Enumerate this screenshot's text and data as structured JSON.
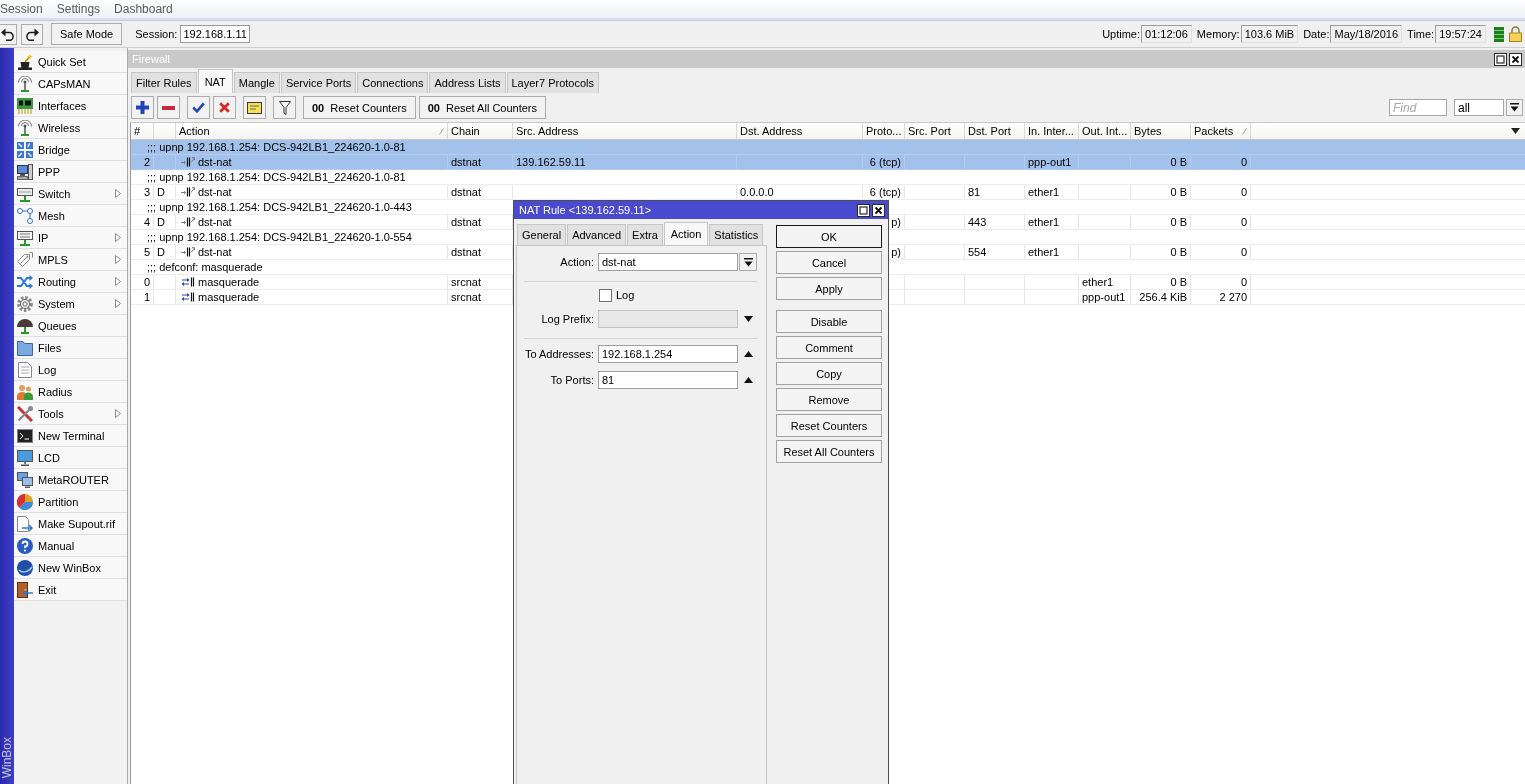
{
  "menu_bar": {
    "items": [
      "Session",
      "Settings",
      "Dashboard"
    ]
  },
  "toolbar": {
    "safe_mode": "Safe Mode",
    "session_label": "Session:",
    "session_value": "192.168.1.11",
    "status": [
      {
        "label": "Uptime:",
        "value": "01:12:06"
      },
      {
        "label": "Memory:",
        "value": "103.6 MiB"
      },
      {
        "label": "Date:",
        "value": "May/18/2016"
      },
      {
        "label": "Time:",
        "value": "19:57:24"
      }
    ]
  },
  "side_label": "WinBox",
  "sidebar": {
    "items": [
      {
        "label": "Quick Set",
        "submenu": false
      },
      {
        "label": "CAPsMAN",
        "submenu": false
      },
      {
        "label": "Interfaces",
        "submenu": false
      },
      {
        "label": "Wireless",
        "submenu": false
      },
      {
        "label": "Bridge",
        "submenu": false
      },
      {
        "label": "PPP",
        "submenu": false
      },
      {
        "label": "Switch",
        "submenu": true
      },
      {
        "label": "Mesh",
        "submenu": false
      },
      {
        "label": "IP",
        "submenu": true
      },
      {
        "label": "MPLS",
        "submenu": true
      },
      {
        "label": "Routing",
        "submenu": true
      },
      {
        "label": "System",
        "submenu": true
      },
      {
        "label": "Queues",
        "submenu": false
      },
      {
        "label": "Files",
        "submenu": false
      },
      {
        "label": "Log",
        "submenu": false
      },
      {
        "label": "Radius",
        "submenu": false
      },
      {
        "label": "Tools",
        "submenu": true
      },
      {
        "label": "New Terminal",
        "submenu": false
      },
      {
        "label": "LCD",
        "submenu": false
      },
      {
        "label": "MetaROUTER",
        "submenu": false
      },
      {
        "label": "Partition",
        "submenu": false
      },
      {
        "label": "Make Supout.rif",
        "submenu": false
      },
      {
        "label": "Manual",
        "submenu": false
      },
      {
        "label": "New WinBox",
        "submenu": false
      },
      {
        "label": "Exit",
        "submenu": false
      }
    ]
  },
  "firewall": {
    "title": "Firewall",
    "tabs": [
      {
        "label": "Filter Rules",
        "selected": false
      },
      {
        "label": "NAT",
        "selected": true
      },
      {
        "label": "Mangle",
        "selected": false
      },
      {
        "label": "Service Ports",
        "selected": false
      },
      {
        "label": "Connections",
        "selected": false
      },
      {
        "label": "Address Lists",
        "selected": false
      },
      {
        "label": "Layer7 Protocols",
        "selected": false
      }
    ],
    "toolbar": {
      "counter_buttons": [
        {
          "glyph": "00",
          "label": "Reset Counters"
        },
        {
          "glyph": "00",
          "label": "Reset All Counters"
        }
      ],
      "find": {
        "placeholder": "Find"
      },
      "filter": {
        "value": "all"
      }
    },
    "table": {
      "columns": [
        {
          "label": "#",
          "sorted": false
        },
        {
          "sorted": false
        },
        {
          "label": "Action",
          "sorted": true
        },
        {
          "label": "Chain",
          "sorted": false
        },
        {
          "label": "Src. Address",
          "sorted": false
        },
        {
          "label": "Dst. Address",
          "sorted": false
        },
        {
          "label": "Proto...",
          "sorted": false
        },
        {
          "label": "Src. Port",
          "sorted": false
        },
        {
          "label": "Dst. Port",
          "sorted": false
        },
        {
          "label": "In. Inter...",
          "sorted": false
        },
        {
          "label": "Out. Int...",
          "sorted": false
        },
        {
          "label": "Bytes",
          "sorted": false
        },
        {
          "label": "Packets",
          "sorted": true
        }
      ],
      "rules": [
        {
          "comment": ";;; upnp 192.168.1.254: DCS-942LB1_224620-1.0-81",
          "number": "2",
          "kind": "forward",
          "action": "dst-nat",
          "chain": "dstnat",
          "src_address": "139.162.59.11",
          "protocol": "6 (tcp)",
          "in_interface": "ppp-out1",
          "bytes": "0 B",
          "packets": "0",
          "selected": true
        },
        {
          "comment": ";;; upnp 192.168.1.254: DCS-942LB1_224620-1.0-81",
          "number": "3",
          "flag": "D",
          "kind": "forward",
          "action": "dst-nat",
          "chain": "dstnat",
          "dst_address": "0.0.0.0",
          "protocol": "6 (tcp)",
          "dst_port": "81",
          "in_interface": "ether1",
          "bytes": "0 B",
          "packets": "0",
          "selected": false
        },
        {
          "comment": ";;; upnp 192.168.1.254: DCS-942LB1_224620-1.0-443",
          "number": "4",
          "flag": "D",
          "kind": "forward",
          "action": "dst-nat",
          "chain": "dstnat",
          "protocol": "p)",
          "dst_port": "443",
          "in_interface": "ether1",
          "bytes": "0 B",
          "packets": "0",
          "selected": false
        },
        {
          "comment": ";;; upnp 192.168.1.254: DCS-942LB1_224620-1.0-554",
          "number": "5",
          "flag": "D",
          "kind": "forward",
          "action": "dst-nat",
          "chain": "dstnat",
          "protocol": "p)",
          "dst_port": "554",
          "in_interface": "ether1",
          "bytes": "0 B",
          "packets": "0",
          "selected": false
        },
        {
          "comment": ";;; defconf: masquerade",
          "number": "0",
          "kind": "swap",
          "action": "masquerade",
          "chain": "srcnat",
          "out_interface": "ether1",
          "bytes": "0 B",
          "packets": "0",
          "selected": false
        },
        {
          "number": "1",
          "kind": "swap",
          "action": "masquerade",
          "chain": "srcnat",
          "out_interface": "ppp-out1",
          "bytes": "256.4 KiB",
          "packets": "2 270",
          "selected": false
        }
      ]
    }
  },
  "dialog": {
    "title": "NAT Rule <139.162.59.11>",
    "tabs": [
      {
        "label": "General",
        "selected": false
      },
      {
        "label": "Advanced",
        "selected": false
      },
      {
        "label": "Extra",
        "selected": false
      },
      {
        "label": "Action",
        "selected": true
      },
      {
        "label": "Statistics",
        "selected": false
      }
    ],
    "fields": [
      {
        "kind": "select",
        "label": "Action:",
        "value": "dst-nat"
      },
      {
        "kind": "separator"
      },
      {
        "kind": "checkbox",
        "label": "Log",
        "checked": false
      },
      {
        "kind": "text",
        "label": "Log Prefix:",
        "disabled": true,
        "expanded": false
      },
      {
        "kind": "separator"
      },
      {
        "kind": "text",
        "label": "To Addresses:",
        "value": "192.168.1.254",
        "disabled": false,
        "expanded": true
      },
      {
        "kind": "text",
        "label": "To Ports:",
        "value": "81",
        "disabled": false,
        "expanded": true
      }
    ],
    "button_groups": [
      [
        {
          "label": "OK",
          "default": true
        },
        {
          "label": "Cancel",
          "default": false
        },
        {
          "label": "Apply",
          "default": false
        }
      ],
      [
        {
          "label": "Disable",
          "default": false
        },
        {
          "label": "Comment",
          "default": false
        },
        {
          "label": "Copy",
          "default": false
        },
        {
          "label": "Remove",
          "default": false
        },
        {
          "label": "Reset Counters",
          "default": false
        },
        {
          "label": "Reset All Counters",
          "default": false
        }
      ]
    ]
  }
}
